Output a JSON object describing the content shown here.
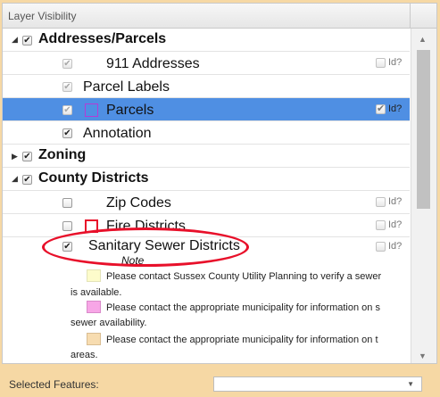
{
  "panel": {
    "title": "Layer Visibility"
  },
  "layers": {
    "addresses_parcels": {
      "label": "Addresses/Parcels",
      "checked": "✔"
    },
    "addresses_911": {
      "label": "911 Addresses",
      "checked": "✔",
      "id_label": "Id?"
    },
    "parcel_labels": {
      "label": "Parcel Labels",
      "checked": "✔"
    },
    "parcels": {
      "label": "Parcels",
      "checked": "✔",
      "id_label": "Id?",
      "id_checked": "✔",
      "swatch_color": "#b43bd6"
    },
    "annotation": {
      "label": "Annotation",
      "checked": "✔"
    },
    "zoning": {
      "label": "Zoning",
      "checked": "✔"
    },
    "county_districts": {
      "label": "County Districts",
      "checked": "✔"
    },
    "zip_codes": {
      "label": "Zip Codes",
      "id_label": "Id?"
    },
    "fire_districts": {
      "label": "Fire Districts",
      "id_label": "Id?",
      "swatch_color": "#e8102a"
    },
    "sanitary_sewer": {
      "label": "Sanitary Sewer Districts",
      "checked": "✔",
      "id_label": "Id?"
    }
  },
  "note": {
    "title": "Note",
    "items": [
      {
        "text": "Please contact Sussex County Utility Planning to verify a sewer",
        "cont": "is available.",
        "color": "#fdfccb"
      },
      {
        "text": "Please contact the appropriate municipality for information on s",
        "cont": "sewer availability.",
        "color": "#f7a6e6"
      },
      {
        "text": "Please contact the appropriate municipality for information on t",
        "cont": "areas.",
        "color": "#f7dcb0"
      }
    ]
  },
  "footer": {
    "selected_label": "Selected Features:",
    "select_value": ""
  },
  "colors": {
    "selected_row": "#4f8fe3",
    "highlight_ellipse": "#e8102a",
    "background": "#f6d8a4"
  }
}
